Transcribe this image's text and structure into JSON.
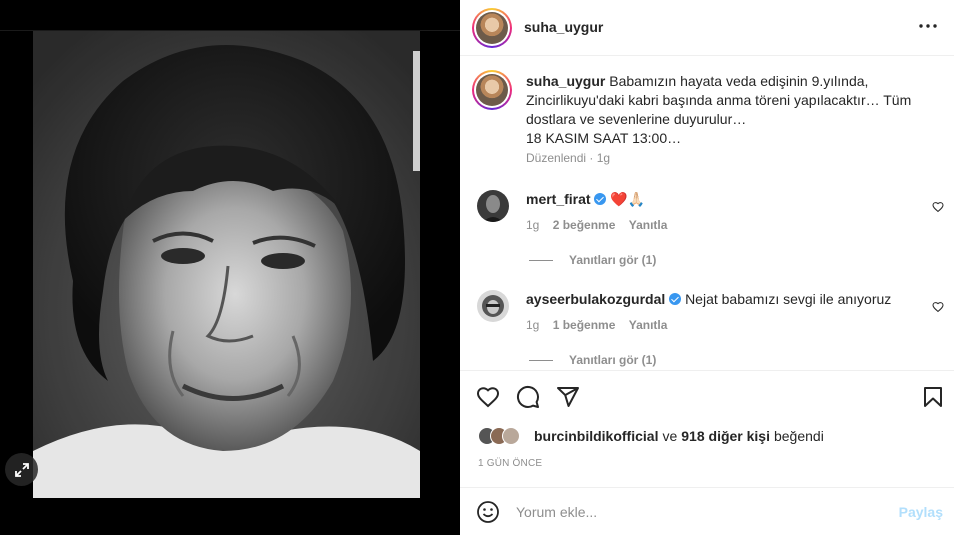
{
  "post": {
    "author": "suha_uygur",
    "more_icon": "more-horizontal-icon"
  },
  "caption": {
    "username": "suha_uygur",
    "text": "Babamızın hayata veda edişinin 9.yılında, Zincirlikuyu'daki kabri başında anma töreni yapılacaktır… Tüm dostlara ve sevenlerine duyurulur…",
    "text2": "18 KASIM SAAT 13:00…",
    "edited": "Düzenlendi",
    "time": "1g"
  },
  "comments": [
    {
      "username": "mert_firat",
      "verified": true,
      "text": "❤️🙏🏻",
      "time": "1g",
      "likes": "2 beğenme",
      "reply": "Yanıtla",
      "view_replies": "Yanıtları gör (1)"
    },
    {
      "username": "ayseerbulakozgurdal",
      "verified": true,
      "text": "Nejat babamızı sevgi ile anıyoruz",
      "time": "1g",
      "likes": "1 beğenme",
      "reply": "Yanıtla",
      "view_replies": "Yanıtları gör (1)"
    }
  ],
  "likes": {
    "first": "burcinbildikofficial",
    "connector": "ve",
    "others": "918 diğer kişi",
    "suffix": "beğendi"
  },
  "timestamp": "1 GÜN ÖNCE",
  "add_comment": {
    "placeholder": "Yorum ekle...",
    "post_label": "Paylaş"
  },
  "colors": {
    "accent_blue": "#0095f6",
    "disabled_blue": "#b2dffc",
    "muted": "#8e8e8e",
    "heart_red": "#ed4956"
  }
}
